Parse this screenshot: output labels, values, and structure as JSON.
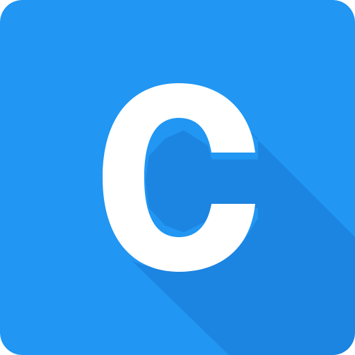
{
  "icon": {
    "name": "letter-c-app-icon",
    "glyph": "C",
    "colors": {
      "background": "#2196F3",
      "shadow": "#1976D2",
      "glyph": "#FFFFFF"
    }
  }
}
